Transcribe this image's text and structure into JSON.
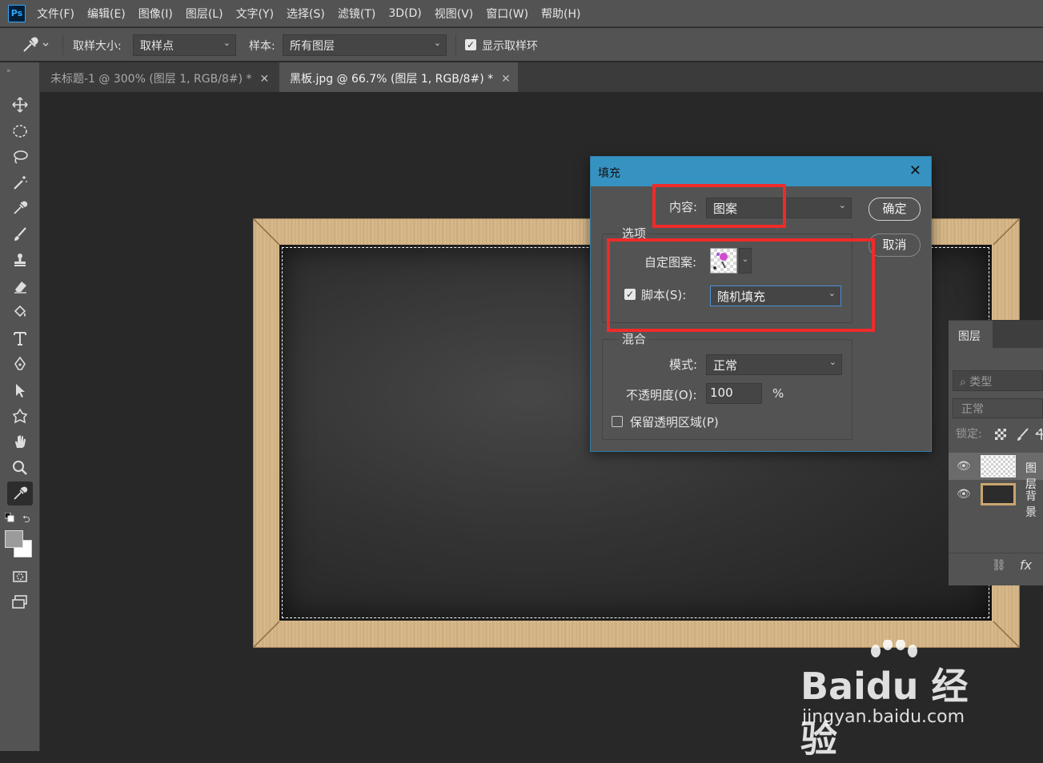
{
  "menubar": {
    "logo": "Ps",
    "items": [
      "文件(F)",
      "编辑(E)",
      "图像(I)",
      "图层(L)",
      "文字(Y)",
      "选择(S)",
      "滤镜(T)",
      "3D(D)",
      "视图(V)",
      "窗口(W)",
      "帮助(H)"
    ]
  },
  "options": {
    "sample_size_label": "取样大小:",
    "sample_size_value": "取样点",
    "sample_label": "样本:",
    "sample_value": "所有图层",
    "show_ring_label": "显示取样环",
    "show_ring_checked": true
  },
  "tabs": [
    {
      "label": "未标题-1 @ 300% (图层 1, RGB/8#) *",
      "active": false
    },
    {
      "label": "黑板.jpg @ 66.7% (图层 1, RGB/8#) *",
      "active": true
    }
  ],
  "tools": [
    "move-icon",
    "marquee-icon",
    "lasso-icon",
    "magic-wand-icon",
    "eyedropper-icon",
    "brush-icon",
    "stamp-icon",
    "eraser-icon",
    "paint-bucket-icon",
    "type-icon",
    "pen-icon",
    "path-select-icon",
    "shape-icon",
    "hand-icon",
    "zoom-icon",
    "eyedropper-active-icon"
  ],
  "dialog": {
    "title": "填充",
    "content_label": "内容:",
    "content_value": "图案",
    "ok_label": "确定",
    "cancel_label": "取消",
    "options_group": "选项",
    "custom_pattern_label": "自定图案:",
    "script_label": "脚本(S):",
    "script_checked": true,
    "script_value": "随机填充",
    "blend_group": "混合",
    "mode_label": "模式:",
    "mode_value": "正常",
    "opacity_label": "不透明度(O):",
    "opacity_value": "100",
    "opacity_unit": "%",
    "preserve_label": "保留透明区域(P)",
    "preserve_checked": false
  },
  "layers_panel": {
    "tab_label": "图层",
    "search_placeholder": "类型",
    "blend_mode": "正常",
    "lock_label": "锁定:",
    "layers": [
      {
        "name": "图层",
        "selected": true
      },
      {
        "name": "背景",
        "selected": false
      }
    ],
    "link_icon": "⛓",
    "fx_label": "fx"
  },
  "watermark": {
    "logo": "Baidu 经验",
    "url": "jingyan.baidu.com"
  },
  "colors": {
    "accent": "#3692c1",
    "highlight": "#ee2b2b"
  }
}
